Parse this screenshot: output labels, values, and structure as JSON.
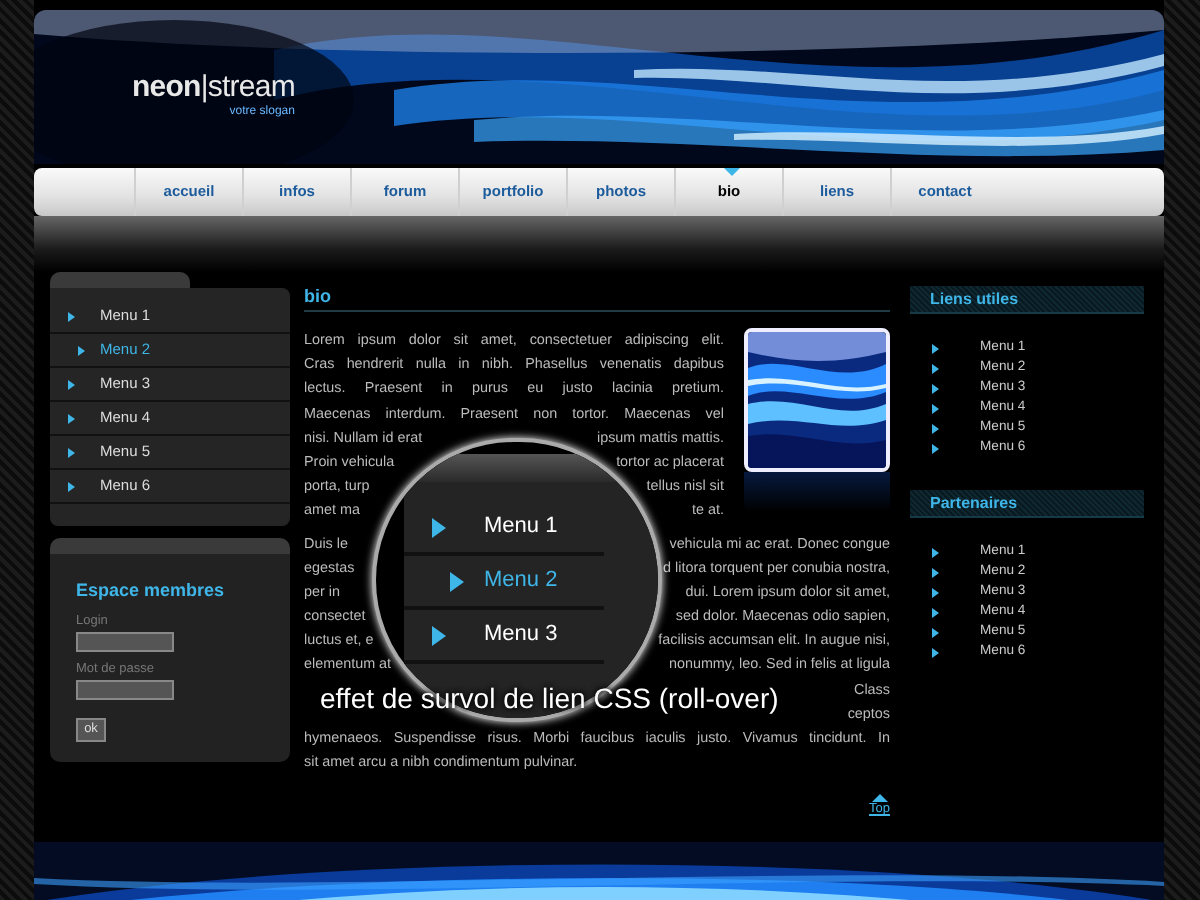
{
  "header": {
    "logo": "**neon**|stream",
    "slogan": "votre slogan"
  },
  "nav": [
    {
      "label": "accueil",
      "selected": false
    },
    {
      "label": "infos",
      "selected": false
    },
    {
      "label": "forum",
      "selected": false
    },
    {
      "label": "portfolio",
      "selected": false
    },
    {
      "label": "photos",
      "selected": false
    },
    {
      "label": "bio",
      "selected": true
    },
    {
      "label": "liens",
      "selected": false
    },
    {
      "label": "contact",
      "selected": false
    }
  ],
  "side_menu": [
    {
      "label": "Menu 1",
      "selected": false
    },
    {
      "label": "Menu 2",
      "selected": true
    },
    {
      "label": "Menu 3",
      "selected": false
    },
    {
      "label": "Menu 4",
      "selected": false
    },
    {
      "label": "Menu 5",
      "selected": false
    },
    {
      "label": "Menu 6",
      "selected": false
    }
  ],
  "login": {
    "title": "Espace membres",
    "fields": [
      {
        "label": "Login"
      },
      {
        "label": "Mot de passe"
      }
    ],
    "button": "ok"
  },
  "content": {
    "title": "bio",
    "paragraph_1": [
      {
        "text": "Lorem ipsum dolor sit amet, consectetuer adipiscing elit."
      },
      {
        "text": "Cras hendrerit nulla in nibh. Phasellus venenatis dapibus"
      },
      {
        "text": "lectus. Praesent in purus eu justo lacinia pretium."
      },
      {
        "text": "Maecenas interdum. Praesent non tortor. Maecenas vel"
      },
      {
        "left": "nisi. Nullam id erat",
        "right": "ipsum mattis mattis."
      },
      {
        "left": "Proin vehicula",
        "right": "tortor ac placerat"
      },
      {
        "left": "porta, turp",
        "right": "tellus nisl sit"
      },
      {
        "left": "amet ma",
        "right": "te at."
      }
    ],
    "paragraph_2": [
      {
        "left": "Duis le",
        "right": "vehicula mi ac erat. Donec congue"
      },
      {
        "left": "egestas",
        "right": "d litora torquent per conubia nostra,"
      },
      {
        "left": "per in",
        "right": "dui. Lorem ipsum dolor sit amet,"
      },
      {
        "left": "consectet",
        "right": "sed dolor. Maecenas odio sapien,"
      },
      {
        "left": "luctus et, e",
        "right": "facilisis accumsan elit. In augue nisi,"
      },
      {
        "left": "elementum at",
        "right": "nonummy, leo. Sed in felis at ligula"
      },
      {
        "right": "Class"
      },
      {
        "right": "ceptos"
      },
      {
        "text": "hymenaeos. Suspendisse risus. Morbi faucibus iaculis justo. Vivamus tincidunt. In"
      },
      {
        "left": "sit amet arcu a nibh condimentum pulvinar."
      }
    ],
    "top_link": "Top"
  },
  "magnifier": {
    "items": [
      {
        "label": "Menu 1",
        "selected": false
      },
      {
        "label": "Menu 2",
        "selected": true
      },
      {
        "label": "Menu 3",
        "selected": false
      }
    ],
    "caption": "effet de survol de lien CSS (roll-over)"
  },
  "right_sections": [
    {
      "title": "Liens utiles",
      "items": [
        "Menu 1",
        "Menu 2",
        "Menu 3",
        "Menu 4",
        "Menu 5",
        "Menu 6"
      ]
    },
    {
      "title": "Partenaires",
      "items": [
        "Menu 1",
        "Menu 2",
        "Menu 3",
        "Menu 4",
        "Menu 5",
        "Menu 6"
      ]
    }
  ]
}
